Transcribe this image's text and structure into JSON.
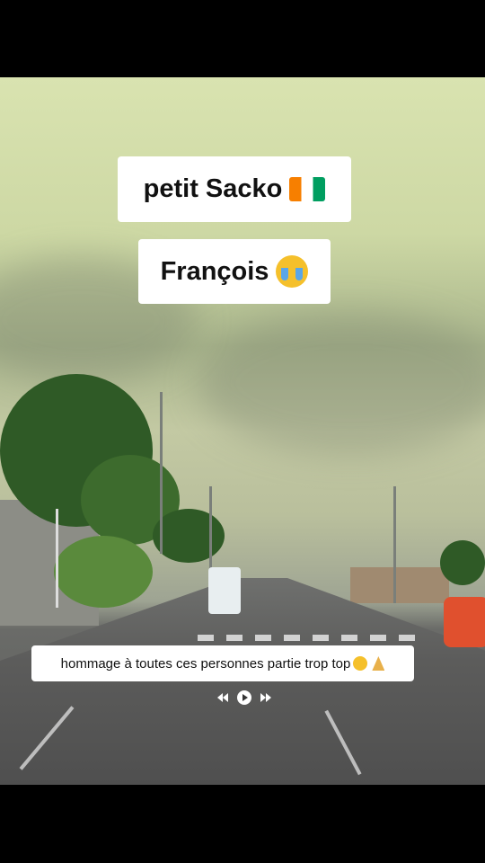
{
  "overlay": {
    "title_line1": "petit Sacko",
    "title_line2": "François",
    "caption": "hommage à toutes ces personnes partie trop top",
    "flag_icon": "ivory-coast-flag-icon",
    "crying_icon": "loudly-crying-face-icon",
    "pray_icon": "folded-hands-icon"
  },
  "player": {
    "controls": [
      "rewind",
      "play",
      "fast-forward"
    ]
  },
  "colors": {
    "sky": "#cdd8a4",
    "road": "#5c5c5b",
    "label_bg": "#ffffff",
    "flag": [
      "#f77f00",
      "#ffffff",
      "#009e60"
    ]
  }
}
